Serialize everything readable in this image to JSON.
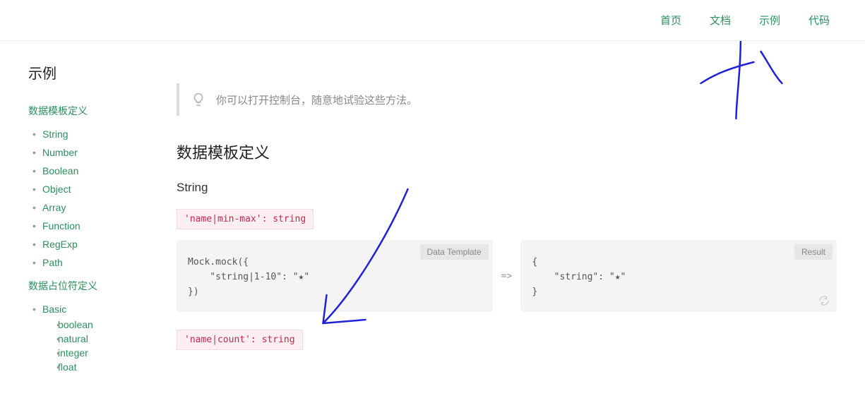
{
  "header": {
    "nav": [
      "首页",
      "文档",
      "示例",
      "代码"
    ]
  },
  "sidebar": {
    "title": "示例",
    "section1": {
      "title": "数据模板定义",
      "items": [
        "String",
        "Number",
        "Boolean",
        "Object",
        "Array",
        "Function",
        "RegExp",
        "Path"
      ]
    },
    "section2": {
      "title": "数据占位符定义",
      "items": [
        {
          "label": "Basic",
          "sub": [
            "boolean",
            "natural",
            "integer",
            "float"
          ]
        }
      ]
    }
  },
  "main": {
    "tip": "你可以打开控制台，随意地试验这些方法。",
    "heading": "数据模板定义",
    "subheading": "String",
    "demo1": {
      "syntax": "'name|min-max': string",
      "template_label": "Data Template",
      "template_code": "Mock.mock({\n    \"string|1-10\": \"★\"\n})",
      "arrow": "=>",
      "result_label": "Result",
      "result_code": "{\n    \"string\": \"★\"\n}"
    },
    "demo2": {
      "syntax": "'name|count': string"
    }
  }
}
